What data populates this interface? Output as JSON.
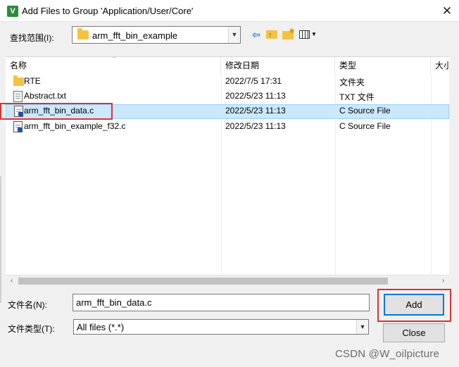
{
  "window": {
    "icon_text": "V",
    "title": "Add Files to Group 'Application/User/Core'",
    "close_glyph": "✕"
  },
  "lookin": {
    "label": "查找范围(I):",
    "value": "arm_fft_bin_example"
  },
  "toolbar": {
    "back_icon": "back-arrow-icon",
    "up_icon": "up-folder-icon",
    "new_icon": "new-folder-icon",
    "view_icon": "view-menu-icon"
  },
  "list": {
    "columns": [
      "名称",
      "修改日期",
      "类型",
      "大小"
    ],
    "rows": [
      {
        "name": "RTE",
        "date": "2022/7/5 17:31",
        "type": "文件夹",
        "icon": "folder-icon",
        "selected": false
      },
      {
        "name": "Abstract.txt",
        "date": "2022/5/23 11:13",
        "type": "TXT 文件",
        "icon": "text-file-icon",
        "selected": false
      },
      {
        "name": "arm_fft_bin_data.c",
        "date": "2022/5/23 11:13",
        "type": "C Source File",
        "icon": "c-file-icon",
        "selected": true
      },
      {
        "name": "arm_fft_bin_example_f32.c",
        "date": "2022/5/23 11:13",
        "type": "C Source File",
        "icon": "c-file-icon",
        "selected": false
      }
    ]
  },
  "filename": {
    "label": "文件名(N):",
    "value": "arm_fft_bin_data.c"
  },
  "filetype": {
    "label": "文件类型(T):",
    "value": "All files (*.*)"
  },
  "buttons": {
    "add": "Add",
    "close": "Close"
  },
  "watermark": "CSDN @W_oilpicture",
  "colors": {
    "highlight": "#e03131",
    "selection": "#cce8ff",
    "folder": "#f5c342"
  }
}
